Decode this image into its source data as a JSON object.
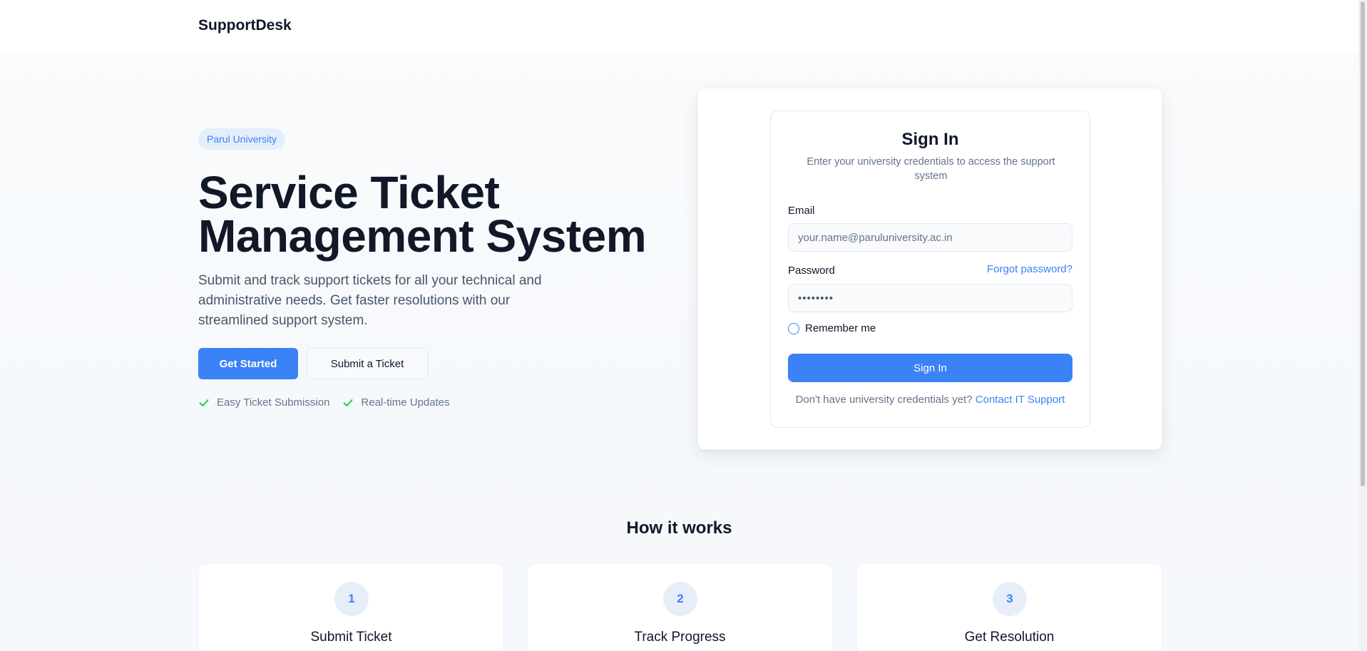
{
  "nav": {
    "brand": "SupportDesk"
  },
  "hero": {
    "badge": "Parul University",
    "title_line1": "Service Ticket",
    "title_line2": "Management System",
    "description": "Submit and track support tickets for all your technical and administrative needs. Get faster resolutions with our streamlined support system.",
    "primary_button": "Get Started",
    "secondary_button": "Submit a Ticket",
    "features": [
      {
        "label": "Easy Ticket Submission",
        "icon": "check-icon"
      },
      {
        "label": "Real-time Updates",
        "icon": "check-icon"
      }
    ]
  },
  "signin": {
    "title": "Sign In",
    "subtitle": "Enter your university credentials to access the support system",
    "email_label": "Email",
    "email_placeholder": "your.name@paruluniversity.ac.in",
    "password_label": "Password",
    "password_value": "••••••••",
    "forgot_link": "Forgot password?",
    "remember_label": "Remember me",
    "button": "Sign In",
    "contact_prefix": "Don't have university credentials yet?",
    "contact_link": "Contact IT Support"
  },
  "how_it_works": {
    "title": "How it works",
    "steps": [
      {
        "number": "1",
        "title": "Submit Ticket"
      },
      {
        "number": "2",
        "title": "Track Progress"
      },
      {
        "number": "3",
        "title": "Get Resolution"
      }
    ]
  },
  "colors": {
    "accent": "#3b82f6",
    "heading": "#111827",
    "muted": "#64748b",
    "success": "#22c55e"
  }
}
